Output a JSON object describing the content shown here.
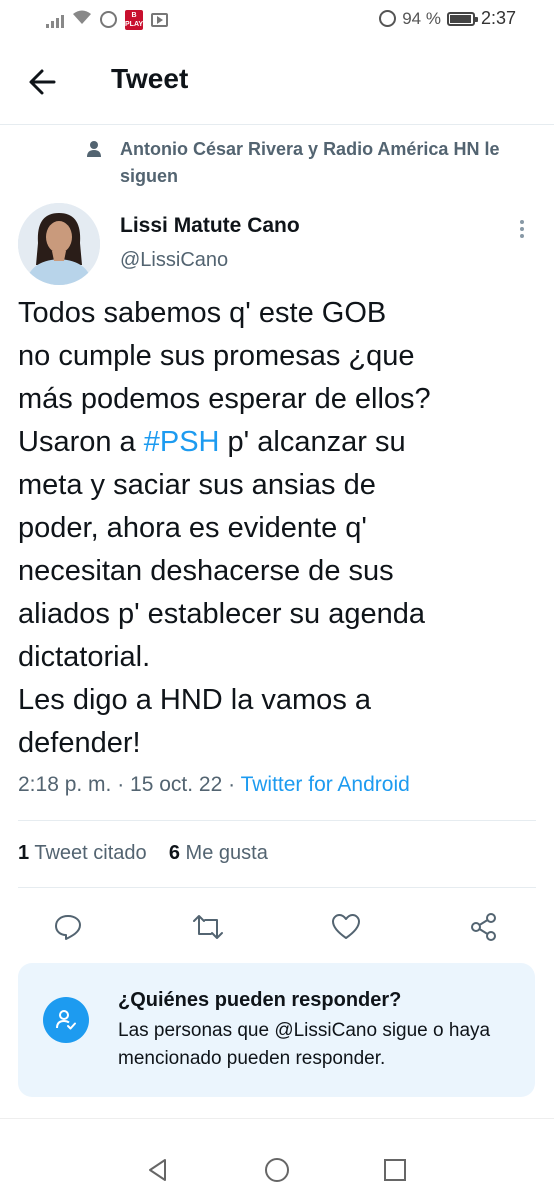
{
  "status_bar": {
    "battery_percent": "94 %",
    "battery_level": 0.94,
    "time": "2:37",
    "badge_text": "B PLAY"
  },
  "header": {
    "title": "Tweet"
  },
  "social_context": {
    "text": "Antonio César Rivera y Radio América HN le siguen"
  },
  "tweet": {
    "author_name": "Lissi Matute Cano",
    "author_handle": "@LissiCano",
    "lines": [
      "Todos sabemos q' este GOB",
      "no cumple sus promesas ¿que",
      "más podemos esperar de ellos?",
      "Usaron a ",
      "#PSH",
      " p' alcanzar su",
      "meta y saciar sus ansias de",
      "poder, ahora es evidente q'",
      "necesitan deshacerse de sus",
      "aliados p' establecer su agenda",
      "dictatorial.",
      "Les digo a HND la vamos a",
      "defender!"
    ],
    "timestamp": "2:18 p. m. · 15 oct. 22 · ",
    "source": "Twitter for Android"
  },
  "stats": {
    "quote_count": "1",
    "quote_label": "Tweet citado",
    "like_count": "6",
    "like_label": "Me gusta"
  },
  "reply_settings": {
    "title": "¿Quiénes pueden responder?",
    "body": "Las personas que @LissiCano sigue o haya mencionado pueden responder."
  },
  "icons": {
    "back": "back-arrow-icon",
    "more": "more-vertical-icon",
    "reply": "reply-icon",
    "retweet": "retweet-icon",
    "like": "heart-icon",
    "share": "share-icon"
  },
  "colors": {
    "accent": "#1d9bf0",
    "secondary_text": "#536471",
    "reply_box_bg": "#ebf5fd"
  }
}
